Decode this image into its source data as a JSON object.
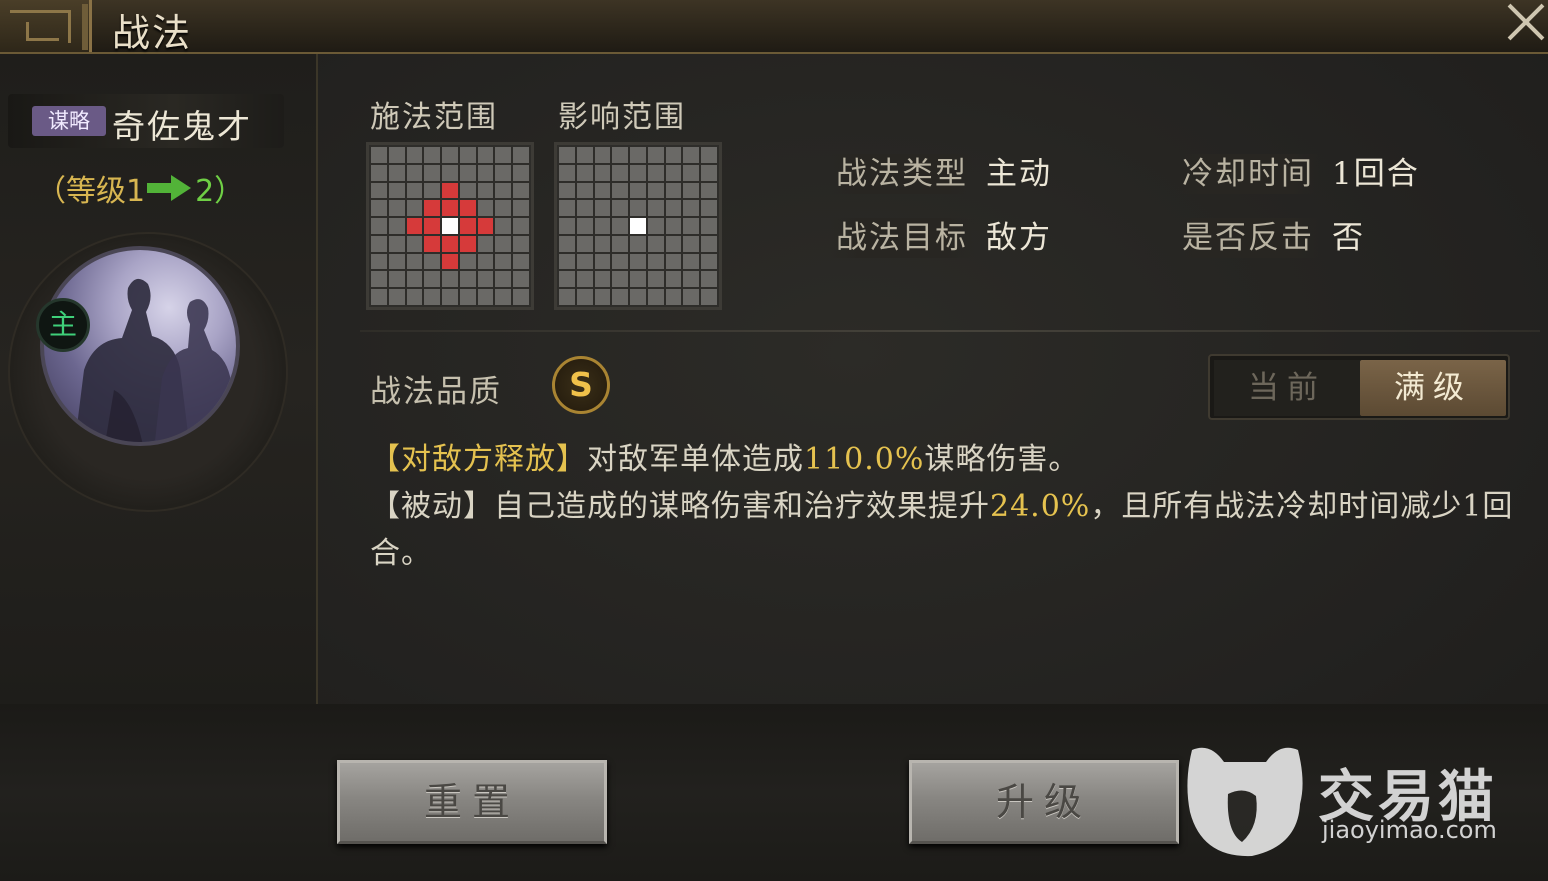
{
  "window": {
    "title": "战法",
    "close_icon": "close-icon"
  },
  "skill": {
    "type_tag": "谋略",
    "type_tag_color": "#6a5a86",
    "name": "奇佐鬼才",
    "level_open": "（等级1",
    "level_next": "2）",
    "active_badge": "主"
  },
  "ranges": {
    "cast_label": "施法范围",
    "effect_label": "影响范围"
  },
  "attributes": {
    "type_label": "战法类型",
    "type_value": "主动",
    "cooldown_label": "冷却时间",
    "cooldown_value": "1回合",
    "target_label": "战法目标",
    "target_value": "敌方",
    "counter_label": "是否反击",
    "counter_value": "否"
  },
  "quality": {
    "label": "战法品质",
    "grade": "S",
    "grade_color": "#f0c14a"
  },
  "toggle": {
    "current_label": "当前",
    "max_label": "满级",
    "selected": "满级"
  },
  "description": {
    "line1_tag": "【对敌方释放】",
    "line1_a": "对敌军单体造成",
    "line1_num": "110.0%",
    "line1_b": "谋略伤害。",
    "line2_tag": "【被动】",
    "line2_a": "自己造成的谋略伤害和治疗效果提升",
    "line2_num": "24.0%",
    "line2_b": "，且所有战法冷却时间减少1回合。"
  },
  "buttons": {
    "reset": "重置",
    "upgrade": "升级"
  },
  "watermark": {
    "name": "交易猫",
    "url": "jiaoyimao.com"
  }
}
